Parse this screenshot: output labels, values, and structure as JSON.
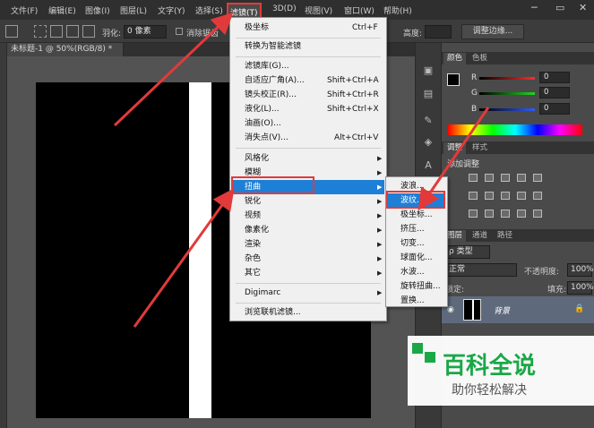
{
  "menubar": {
    "items": [
      "文件(F)",
      "编辑(E)",
      "图像(I)",
      "图层(L)",
      "文字(Y)",
      "选择(S)",
      "滤镜(T)",
      "3D(D)",
      "视图(V)",
      "窗口(W)",
      "帮助(H)"
    ],
    "active": "滤镜(T)",
    "window_controls": [
      "─",
      "▭",
      "✕"
    ]
  },
  "options_bar": {
    "feather_label": "羽化:",
    "feather_value": "0 像素",
    "antialias_label": "消除锯齿",
    "height_label": "高度:",
    "refine_button": "调整边缘..."
  },
  "document": {
    "tab_title": "未标题-1 @ 50%(RGB/8) *"
  },
  "filter_menu": {
    "items": [
      {
        "label": "极坐标",
        "shortcut": "Ctrl+F"
      },
      {
        "label": "转换为智能滤镜"
      },
      {
        "label": "滤镜库(G)..."
      },
      {
        "label": "自适应广角(A)...",
        "shortcut": "Shift+Ctrl+A"
      },
      {
        "label": "镜头校正(R)...",
        "shortcut": "Shift+Ctrl+R"
      },
      {
        "label": "液化(L)...",
        "shortcut": "Shift+Ctrl+X"
      },
      {
        "label": "油画(O)..."
      },
      {
        "label": "消失点(V)...",
        "shortcut": "Alt+Ctrl+V"
      },
      {
        "label": "风格化"
      },
      {
        "label": "模糊"
      },
      {
        "label": "扭曲"
      },
      {
        "label": "锐化"
      },
      {
        "label": "视频"
      },
      {
        "label": "像素化"
      },
      {
        "label": "渲染"
      },
      {
        "label": "杂色"
      },
      {
        "label": "其它"
      },
      {
        "label": "Digimarc"
      },
      {
        "label": "浏览联机滤镜..."
      }
    ],
    "highlighted": "扭曲"
  },
  "distort_submenu": {
    "items": [
      "波浪...",
      "波纹...",
      "极坐标...",
      "挤压...",
      "切变...",
      "球面化...",
      "水波...",
      "旋转扭曲...",
      "置换..."
    ],
    "highlighted": "波纹..."
  },
  "color_panel": {
    "tabs": [
      "颜色",
      "色板"
    ],
    "channels": [
      {
        "label": "R",
        "value": "0",
        "color": "#ff2b2b"
      },
      {
        "label": "G",
        "value": "0",
        "color": "#1fd61f"
      },
      {
        "label": "B",
        "value": "0",
        "color": "#2f5bff"
      }
    ]
  },
  "adjust_panel": {
    "tabs": [
      "调整",
      "样式"
    ],
    "title": "添加调整"
  },
  "layers_panel": {
    "tabs": [
      "图层",
      "通道",
      "路径"
    ],
    "kind_label": "ρ 类型",
    "blend_mode": "正常",
    "opacity_label": "不透明度:",
    "opacity_value": "100%",
    "lock_label": "锁定:",
    "fill_label": "填充:",
    "fill_value": "100%",
    "layer_name": "背景"
  },
  "watermark": {
    "title": "百科全说",
    "subtitle": "助你轻松解决"
  },
  "colors": {
    "accent_red": "#e23a3a",
    "highlight_blue": "#1e7fd6",
    "brand_green": "#1aa847"
  }
}
